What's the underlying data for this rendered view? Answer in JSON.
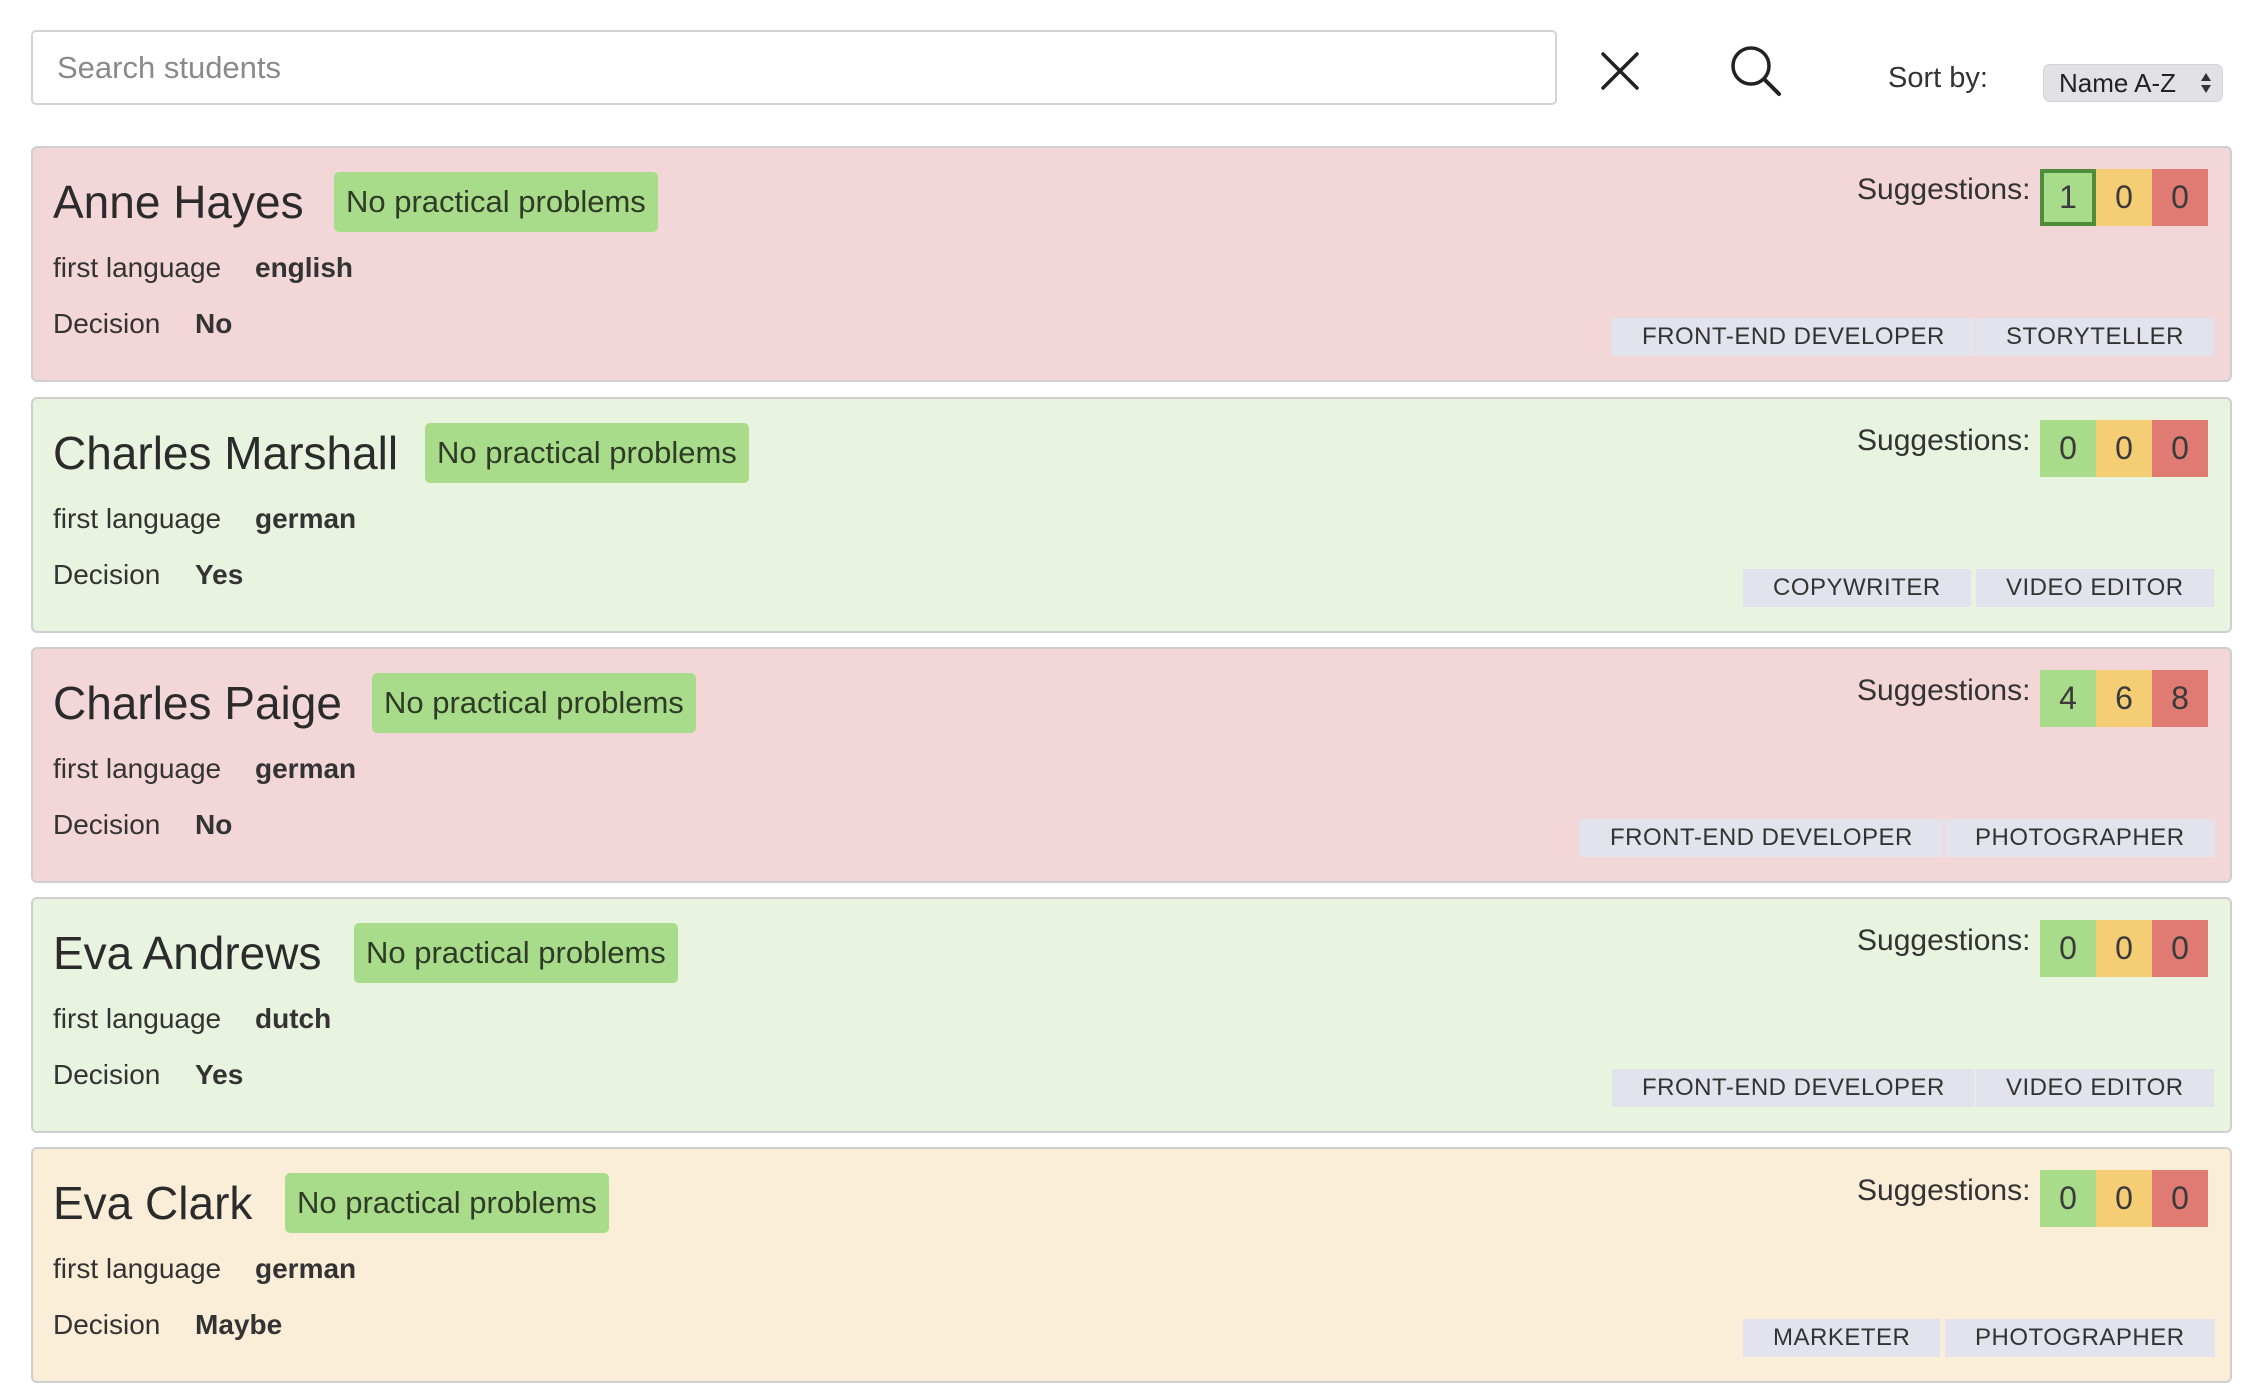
{
  "search": {
    "placeholder": "Search students",
    "value": ""
  },
  "sort": {
    "label": "Sort by:",
    "selected": "Name A-Z"
  },
  "icons": {
    "clear": "close-icon",
    "search": "search-icon",
    "sort": "sort-arrows-icon"
  },
  "colors": {
    "card_no": "#f3d6d7",
    "card_yes": "#e8f4df",
    "card_maybe": "#fbeed8",
    "badge": "#a9dc8a",
    "sugg_yes": "#a9dc8a",
    "sugg_maybe": "#f5cd75",
    "sugg_no": "#e07b73",
    "tag": "#e2e3ec"
  },
  "labels": {
    "first_language": "first language",
    "decision": "Decision",
    "suggestions": "Suggestions:"
  },
  "students": [
    {
      "name": "Anne Hayes",
      "status": "No practical problems",
      "language": "english",
      "decision": "No",
      "suggestions": {
        "yes": "1",
        "maybe": "0",
        "no": "0"
      },
      "tags": [
        "FRONT-END DEVELOPER",
        "STORYTELLER"
      ]
    },
    {
      "name": "Charles Marshall",
      "status": "No practical problems",
      "language": "german",
      "decision": "Yes",
      "suggestions": {
        "yes": "0",
        "maybe": "0",
        "no": "0"
      },
      "tags": [
        "COPYWRITER",
        "VIDEO EDITOR"
      ]
    },
    {
      "name": "Charles Paige",
      "status": "No practical problems",
      "language": "german",
      "decision": "No",
      "suggestions": {
        "yes": "4",
        "maybe": "6",
        "no": "8"
      },
      "tags": [
        "FRONT-END DEVELOPER",
        "PHOTOGRAPHER"
      ]
    },
    {
      "name": "Eva Andrews",
      "status": "No practical problems",
      "language": "dutch",
      "decision": "Yes",
      "suggestions": {
        "yes": "0",
        "maybe": "0",
        "no": "0"
      },
      "tags": [
        "FRONT-END DEVELOPER",
        "VIDEO EDITOR"
      ]
    },
    {
      "name": "Eva Clark",
      "status": "No practical problems",
      "language": "german",
      "decision": "Maybe",
      "suggestions": {
        "yes": "0",
        "maybe": "0",
        "no": "0"
      },
      "tags": [
        "MARKETER",
        "PHOTOGRAPHER"
      ]
    }
  ]
}
